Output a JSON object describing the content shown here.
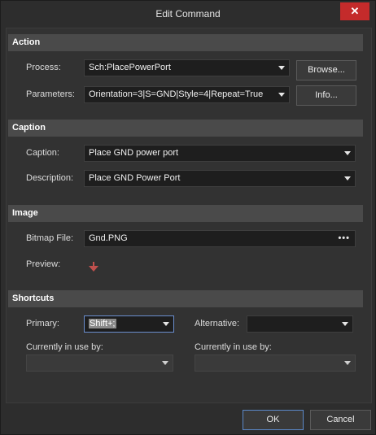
{
  "window": {
    "title": "Edit Command",
    "close_label": "✕"
  },
  "action": {
    "header": "Action",
    "process_label": "Process:",
    "process_value": "Sch:PlacePowerPort",
    "parameters_label": "Parameters:",
    "parameters_value": "Orientation=3|S=GND|Style=4|Repeat=True",
    "browse_label": "Browse...",
    "info_label": "Info..."
  },
  "caption": {
    "header": "Caption",
    "caption_label": "Caption:",
    "caption_value": "Place GND power port",
    "description_label": "Description:",
    "description_value": "Place GND Power Port"
  },
  "image": {
    "header": "Image",
    "bitmap_label": "Bitmap File:",
    "bitmap_value": "Gnd.PNG",
    "preview_label": "Preview:",
    "preview_icon": "gnd-power-port-icon",
    "preview_color": "#c0504d"
  },
  "shortcuts": {
    "header": "Shortcuts",
    "primary_label": "Primary:",
    "primary_value": "Shift+;",
    "alternative_label": "Alternative:",
    "alternative_value": "",
    "in_use_label_left": "Currently in use by:",
    "in_use_value_left": "",
    "in_use_label_right": "Currently in use by:",
    "in_use_value_right": ""
  },
  "footer": {
    "ok_label": "OK",
    "cancel_label": "Cancel"
  }
}
